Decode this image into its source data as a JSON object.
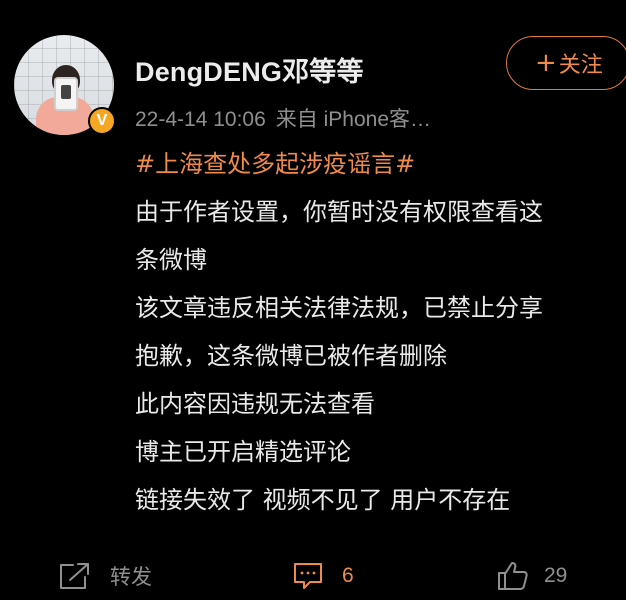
{
  "post": {
    "author": {
      "name": "DengDENG邓等等",
      "verified_badge": "V"
    },
    "meta": {
      "time": "22-4-14 10:06",
      "source": "来自 iPhone客…"
    },
    "follow_label": "关注",
    "content": {
      "hashtag": "#上海查处多起涉疫谣言#",
      "lines": [
        "由于作者设置，你暂时没有权限查看这",
        "条微博",
        "该文章违反相关法律法规，已禁止分享",
        "抱歉，这条微博已被作者删除",
        "此内容因违规无法查看",
        "博主已开启精选评论",
        "链接失效了 视频不见了 用户不存在"
      ]
    },
    "actions": {
      "repost_label": "转发",
      "comment_count": "6",
      "like_count": "29"
    },
    "icons": {
      "repost": "share-arrow-icon",
      "comment": "comment-bubble-icon",
      "like": "thumbs-up-icon",
      "follow": "plus-icon",
      "verified": "verified-v-badge-icon"
    },
    "colors": {
      "background": "#000000",
      "accent": "#f08a4b",
      "badge": "#f5a623",
      "muted": "#8f8f8f",
      "text": "#e9e9e9"
    }
  }
}
